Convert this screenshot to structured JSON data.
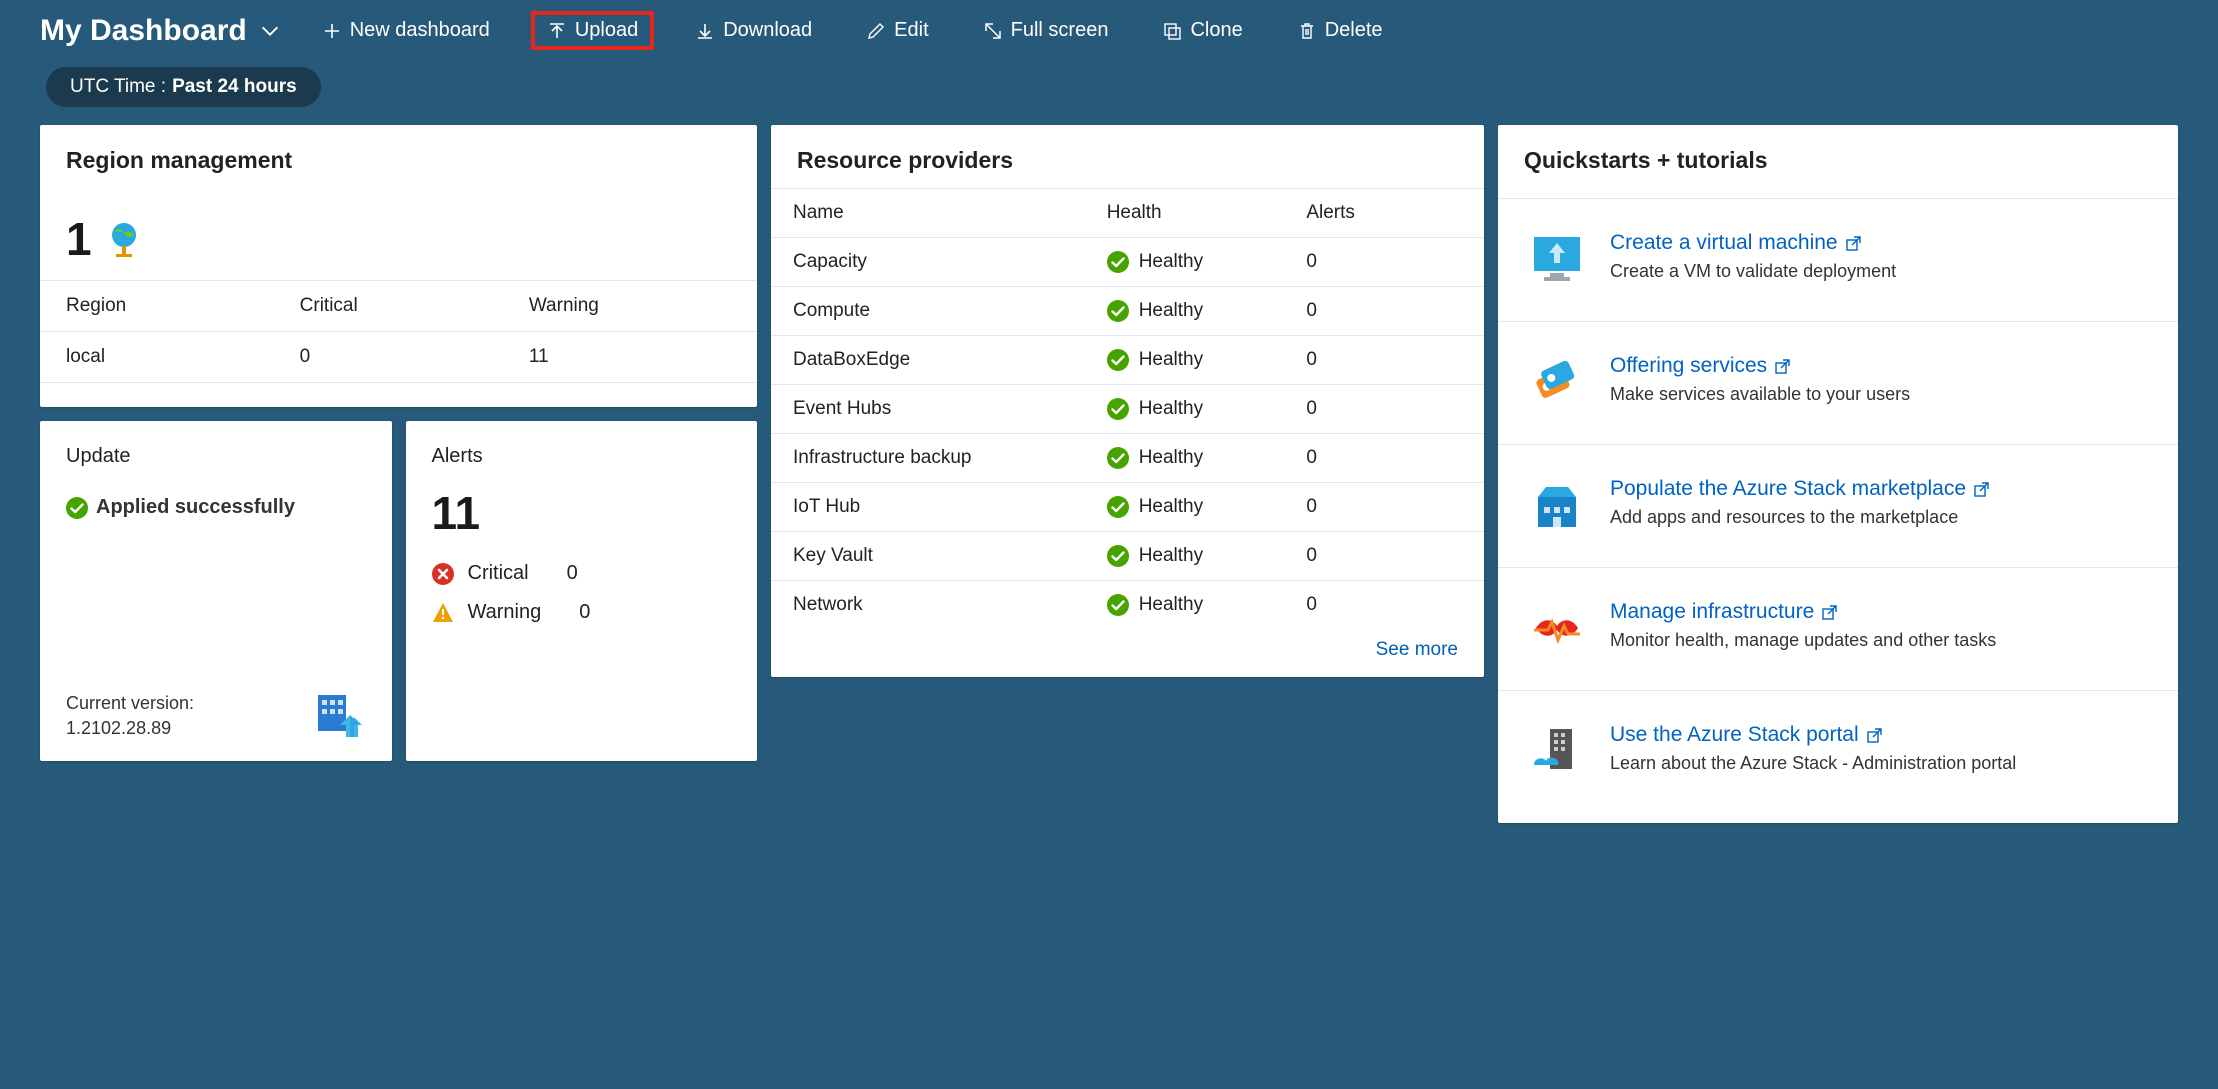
{
  "header": {
    "title": "My Dashboard",
    "actions": {
      "new_dashboard": "New dashboard",
      "upload": "Upload",
      "download": "Download",
      "edit": "Edit",
      "full_screen": "Full screen",
      "clone": "Clone",
      "delete": "Delete"
    },
    "time_label": "UTC Time :",
    "time_value": "Past 24 hours"
  },
  "region": {
    "title": "Region management",
    "count": "1",
    "headers": {
      "region": "Region",
      "critical": "Critical",
      "warning": "Warning"
    },
    "rows": [
      {
        "region": "local",
        "critical": "0",
        "warning": "11"
      }
    ]
  },
  "update": {
    "title": "Update",
    "status": "Applied successfully",
    "version_label": "Current version:",
    "version": "1.2102.28.89"
  },
  "alerts": {
    "title": "Alerts",
    "total": "11",
    "rows": [
      {
        "label": "Critical",
        "count": "0"
      },
      {
        "label": "Warning",
        "count": "0"
      }
    ]
  },
  "resource_providers": {
    "title": "Resource providers",
    "headers": {
      "name": "Name",
      "health": "Health",
      "alerts": "Alerts"
    },
    "rows": [
      {
        "name": "Capacity",
        "health": "Healthy",
        "alerts": "0"
      },
      {
        "name": "Compute",
        "health": "Healthy",
        "alerts": "0"
      },
      {
        "name": "DataBoxEdge",
        "health": "Healthy",
        "alerts": "0"
      },
      {
        "name": "Event Hubs",
        "health": "Healthy",
        "alerts": "0"
      },
      {
        "name": "Infrastructure backup",
        "health": "Healthy",
        "alerts": "0"
      },
      {
        "name": "IoT Hub",
        "health": "Healthy",
        "alerts": "0"
      },
      {
        "name": "Key Vault",
        "health": "Healthy",
        "alerts": "0"
      },
      {
        "name": "Network",
        "health": "Healthy",
        "alerts": "0"
      }
    ],
    "see_more": "See more"
  },
  "quickstarts": {
    "title": "Quickstarts + tutorials",
    "items": [
      {
        "title": "Create a virtual machine",
        "desc": "Create a VM to validate deployment"
      },
      {
        "title": "Offering services",
        "desc": "Make services available to your users"
      },
      {
        "title": "Populate the Azure Stack marketplace",
        "desc": "Add apps and resources to the marketplace"
      },
      {
        "title": "Manage infrastructure",
        "desc": "Monitor health, manage updates and other tasks"
      },
      {
        "title": "Use the Azure Stack portal",
        "desc": "Learn about the Azure Stack - Administration portal"
      }
    ]
  }
}
